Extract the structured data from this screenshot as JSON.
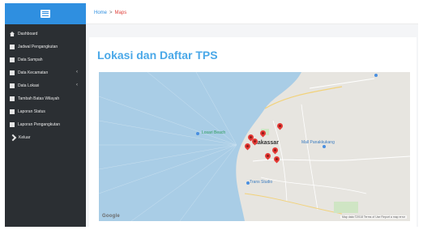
{
  "sidebar": {
    "accent": "#2f8fe0",
    "items": [
      {
        "label": "Dashboard",
        "icon": "home-icon",
        "has_children": false
      },
      {
        "label": "Jadwal Pengangkutan",
        "icon": "document-icon",
        "has_children": false
      },
      {
        "label": "Data Sampah",
        "icon": "document-icon",
        "has_children": false
      },
      {
        "label": "Data Kecamatan",
        "icon": "document-icon",
        "has_children": true
      },
      {
        "label": "Data Lokasi",
        "icon": "document-icon",
        "has_children": true
      },
      {
        "label": "Tambah Batas Wilayah",
        "icon": "document-icon",
        "has_children": false
      },
      {
        "label": "Laporan Status",
        "icon": "document-icon",
        "has_children": false
      },
      {
        "label": "Laporan Pengangkutan",
        "icon": "document-icon",
        "has_children": false
      },
      {
        "label": "Keluar",
        "icon": "exit-icon",
        "has_children": false
      }
    ]
  },
  "breadcrumb": {
    "home": "Home",
    "separator": ">",
    "current": "Maps"
  },
  "page": {
    "title": "Lokasi dan Daftar TPS"
  },
  "map": {
    "city_label": "Makassar",
    "poi_labels": [
      "Losari Beach",
      "Mall Panakkukang",
      "Trans Studio"
    ],
    "google_label": "Google",
    "attribution": "Map data ©2018  Terms of Use  Report a map error",
    "marker_color": "#e53935",
    "marker_count": 8
  }
}
